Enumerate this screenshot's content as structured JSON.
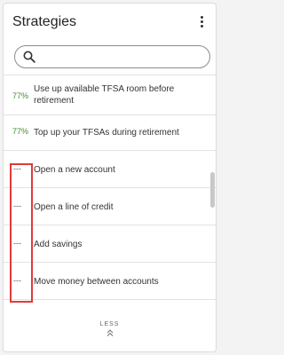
{
  "header": {
    "title": "Strategies",
    "menu_icon": "more-vertical-icon"
  },
  "search": {
    "placeholder": "",
    "value": "",
    "icon": "search-icon"
  },
  "strategies": [
    {
      "score": "77%",
      "label": "Use up available TFSA room before retirement"
    },
    {
      "score": "77%",
      "label": "Top up your TFSAs during retirement"
    },
    {
      "score": "---",
      "label": "Open a new account"
    },
    {
      "score": "---",
      "label": "Open a line of credit"
    },
    {
      "score": "---",
      "label": "Add savings"
    },
    {
      "score": "---",
      "label": "Move money between accounts"
    }
  ],
  "footer": {
    "less_label": "LESS",
    "less_icon": "double-chevron-up-icon"
  },
  "colors": {
    "score_green": "#3e8e2c",
    "highlight_red": "#e03a3a"
  }
}
